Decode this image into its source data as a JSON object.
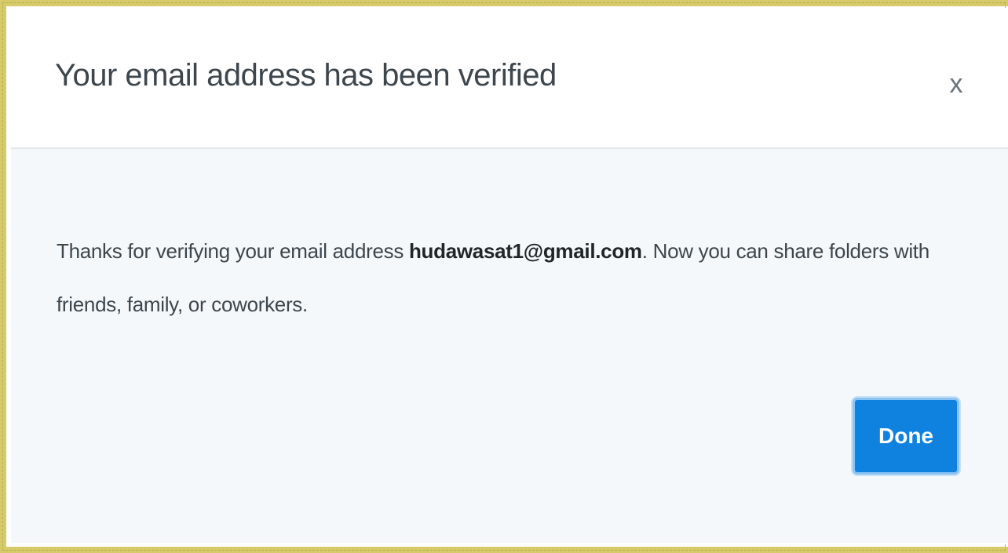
{
  "dialog": {
    "title": "Your email address has been verified",
    "close_icon": "close-icon",
    "close_glyph": "x",
    "message": {
      "prefix": "Thanks for verifying your email address ",
      "email": "hudawasat1@gmail.com",
      "suffix": ". Now you can share folders with friends, family, or coworkers."
    },
    "done_label": "Done"
  },
  "colors": {
    "accent": "#0f82e0",
    "body_background": "#f5f8fa",
    "frame_border": "#d8c96a"
  }
}
